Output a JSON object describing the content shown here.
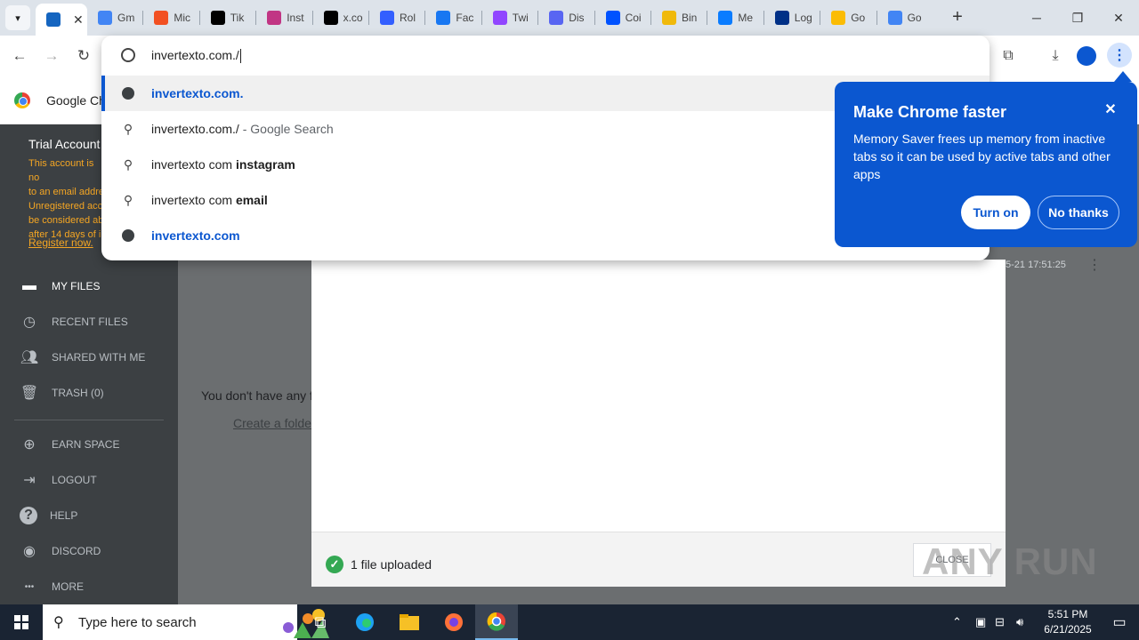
{
  "tabs": [
    {
      "label": "",
      "favicon": "anyrun-icon",
      "color": "#1565c0",
      "active": true
    },
    {
      "label": "Gm",
      "favicon": "google-icon",
      "color": "#4285f4"
    },
    {
      "label": "Mic",
      "favicon": "microsoft-icon",
      "color": "#f25022"
    },
    {
      "label": "Tik",
      "favicon": "tiktok-icon",
      "color": "#000000"
    },
    {
      "label": "Inst",
      "favicon": "instagram-icon",
      "color": "#c13584"
    },
    {
      "label": "x.co",
      "favicon": "x-icon",
      "color": "#000000"
    },
    {
      "label": "Rol",
      "favicon": "roblox-icon",
      "color": "#335fff"
    },
    {
      "label": "Fac",
      "favicon": "facebook-icon",
      "color": "#1877f2"
    },
    {
      "label": "Twi",
      "favicon": "twitch-icon",
      "color": "#9146ff"
    },
    {
      "label": "Dis",
      "favicon": "discord-icon",
      "color": "#5865f2"
    },
    {
      "label": "Coi",
      "favicon": "coinbase-icon",
      "color": "#0052ff"
    },
    {
      "label": "Bin",
      "favicon": "binance-icon",
      "color": "#f0b90b"
    },
    {
      "label": "Me",
      "favicon": "messenger-icon",
      "color": "#0a7cff"
    },
    {
      "label": "Log",
      "favicon": "paypal-icon",
      "color": "#003087"
    },
    {
      "label": "Go",
      "favicon": "google-photos-icon",
      "color": "#fbbc05"
    },
    {
      "label": "Go",
      "favicon": "google-icon",
      "color": "#4285f4"
    }
  ],
  "omnibox": {
    "value": "invertexto.com./",
    "suggestions": [
      {
        "url": "invertexto.com.",
        "type": "url",
        "selected": true
      },
      {
        "prefix": "invertexto.com./",
        "suffix": " - Google Search",
        "type": "search"
      },
      {
        "prefix": "invertexto com ",
        "bold": "instagram",
        "type": "search"
      },
      {
        "prefix": "invertexto com ",
        "bold": "email",
        "type": "search"
      },
      {
        "url": "invertexto.com",
        "type": "url"
      }
    ]
  },
  "bookmark": {
    "label": "Google Ch"
  },
  "sidebar": {
    "trial_title": "Trial Account",
    "trial_text": "This account is no\nto an email addre\nUnregistered acc\nbe considered ab\nafter 14 days of i\nunless you regist",
    "register_link": "Register now.",
    "items": [
      {
        "label": "MY FILES",
        "icon": "folder-icon",
        "active": true
      },
      {
        "label": "RECENT FILES",
        "icon": "clock-icon"
      },
      {
        "label": "SHARED WITH ME",
        "icon": "people-icon"
      },
      {
        "label": "TRASH (0)",
        "icon": "trash-icon"
      },
      {
        "label": "EARN SPACE",
        "icon": "plus-circle-icon"
      },
      {
        "label": "LOGOUT",
        "icon": "logout-icon"
      },
      {
        "label": "HELP",
        "icon": "help-icon"
      },
      {
        "label": "DISCORD",
        "icon": "discord-icon"
      },
      {
        "label": "MORE",
        "icon": "more-icon"
      }
    ]
  },
  "main": {
    "empty_text": "You don't have any f",
    "create_folder": "Create a folde",
    "date_fragment": "5-21 17:51:25"
  },
  "modal": {
    "upload_status": "1 file uploaded",
    "close_label": "CLOSE"
  },
  "popup": {
    "title": "Make Chrome faster",
    "body": "Memory Saver frees up memory from inactive tabs so it can be used by active tabs and other apps",
    "turn_on": "Turn on",
    "no_thanks": "No thanks"
  },
  "watermark": "ANY RUN",
  "taskbar": {
    "search_placeholder": "Type here to search",
    "time": "5:51 PM",
    "date": "6/21/2025"
  }
}
